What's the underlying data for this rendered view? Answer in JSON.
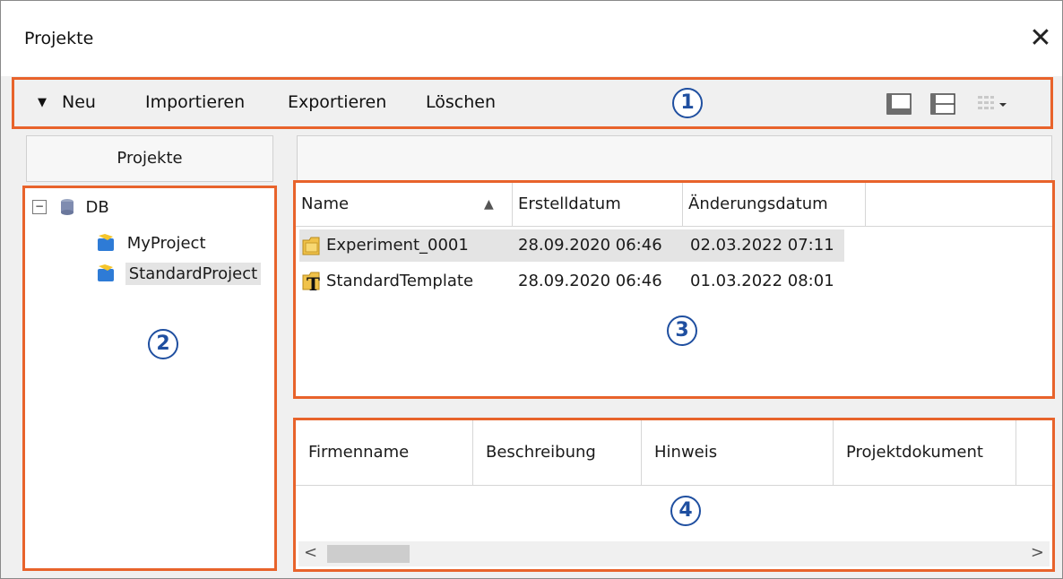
{
  "window": {
    "title": "Projekte",
    "close_glyph": "✕"
  },
  "toolbar": {
    "items": [
      "Neu",
      "Importieren",
      "Exportieren",
      "Löschen"
    ],
    "dropdown_glyph": "▼",
    "layout_icons": [
      "layout-left-pane-icon",
      "layout-bottom-pane-icon",
      "columns-dropdown-icon"
    ]
  },
  "callouts": [
    "1",
    "2",
    "3",
    "4"
  ],
  "left_panel": {
    "header": "Projekte",
    "tree": {
      "root": {
        "label": "DB",
        "expander": "−"
      },
      "children": [
        "MyProject",
        "StandardProject"
      ],
      "selected": "StandardProject"
    }
  },
  "project_list": {
    "columns": [
      "Name",
      "Erstelldatum",
      "Änderungsdatum"
    ],
    "sort_glyph": "▲",
    "rows": [
      {
        "name": "Experiment_0001",
        "created": "28.09.2020 06:46",
        "modified": "02.03.2022 07:11",
        "icon": "project-folder-icon"
      },
      {
        "name": "StandardTemplate",
        "created": "28.09.2020 06:46",
        "modified": "01.03.2022 08:01",
        "icon": "template-folder-icon"
      }
    ]
  },
  "details": {
    "columns": [
      "Firmenname",
      "Beschreibung",
      "Hinweis",
      "Projektdokument"
    ],
    "scroll_left": "<",
    "scroll_right": ">"
  },
  "colors": {
    "accent_border": "#e8632b",
    "callout": "#1f4fa0",
    "selection": "#e4e4e4"
  }
}
